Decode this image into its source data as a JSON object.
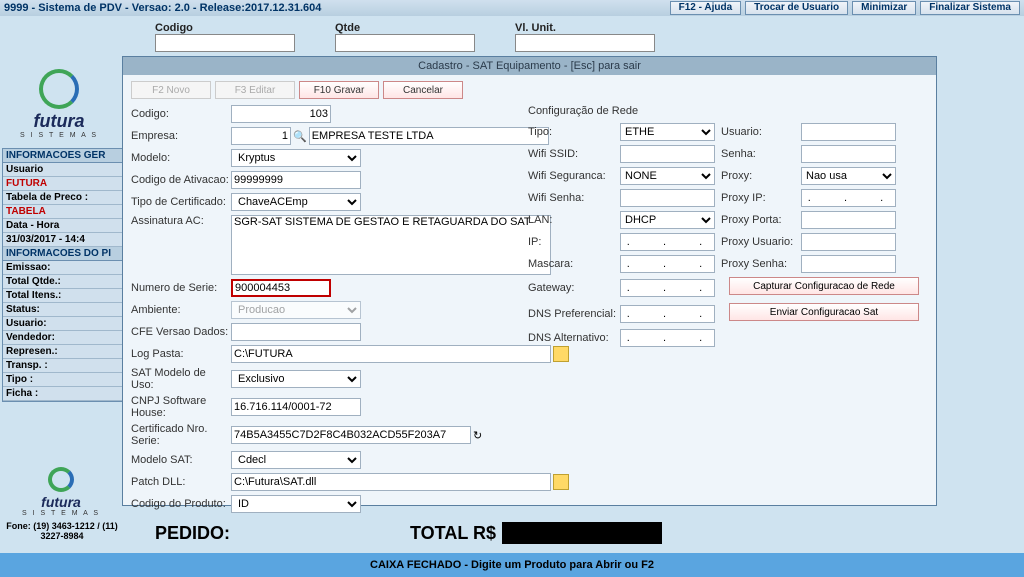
{
  "titlebar": {
    "text": "9999 - Sistema de PDV - Versao: 2.0 - Release:2017.12.31.604",
    "buttons": {
      "help": "F12 - Ajuda",
      "switch": "Trocar de Usuario",
      "min": "Minimizar",
      "exit": "Finalizar Sistema"
    }
  },
  "topfields": {
    "codigo": "Codigo",
    "qtde": "Qtde",
    "vlunit": "Vl. Unit."
  },
  "logo": {
    "brand": "futura",
    "sub": "S I S T E M A S"
  },
  "side": {
    "info_title": "INFORMACOES GER",
    "usuario_lbl": "Usuario",
    "usuario_val": "FUTURA",
    "tabela_lbl": "Tabela de Preco :",
    "tabela_val": "TABELA",
    "datahora_lbl": "Data - Hora",
    "datahora_val": "31/03/2017 - 14:4",
    "infopi": "INFORMACOES DO PI",
    "rows": [
      "Emissao:",
      "Total Qtde.:",
      "Total Itens.:",
      "Status:",
      "Usuario:",
      "Vendedor:",
      "Represen.:",
      "Transp. :",
      "Tipo :",
      "Ficha :"
    ],
    "fone": "Fone: (19) 3463-1212 / (11) 3227-8984"
  },
  "order": {
    "pedido": "PEDIDO:",
    "total": "TOTAL R$"
  },
  "status": "CAIXA FECHADO - Digite um Produto para Abrir ou F2",
  "modal": {
    "title": "Cadastro - SAT Equipamento - [Esc] para sair",
    "btns": {
      "novo": "F2 Novo",
      "editar": "F3 Editar",
      "gravar": "F10 Gravar",
      "cancelar": "Cancelar"
    },
    "left": {
      "codigo": "Codigo:",
      "codigo_val": "103",
      "empresa": "Empresa:",
      "empresa_num": "1",
      "empresa_name": "EMPRESA TESTE LTDA",
      "modelo": "Modelo:",
      "modelo_val": "Kryptus",
      "ativacao": "Codigo de Ativacao:",
      "ativacao_val": "99999999",
      "tipocert": "Tipo de Certificado:",
      "tipocert_val": "ChaveACEmp",
      "assinatura": "Assinatura AC:",
      "assinatura_val": "SGR-SAT SISTEMA DE GESTAO E RETAGUARDA DO SAT",
      "numserie": "Numero de Serie:",
      "numserie_val": "900004453",
      "ambiente": "Ambiente:",
      "ambiente_val": "Producao",
      "cfe": "CFE Versao Dados:",
      "logpasta": "Log Pasta:",
      "logpasta_val": "C:\\FUTURA",
      "satmodelo": "SAT Modelo de Uso:",
      "satmodelo_val": "Exclusivo",
      "cnpj": "CNPJ Software House:",
      "cnpj_val": "16.716.114/0001-72",
      "certnro": "Certificado Nro. Serie:",
      "certnro_val": "74B5A3455C7D2F8C4B032ACD55F203A7",
      "modelosat": "Modelo SAT:",
      "modelosat_val": "Cdecl",
      "patch": "Patch DLL:",
      "patch_val": "C:\\Futura\\SAT.dll",
      "codprod": "Codigo do Produto:",
      "codprod_val": "ID"
    },
    "right": {
      "title": "Configuração de Rede",
      "tipo": "Tipo:",
      "tipo_val": "ETHE",
      "ssid": "Wifi SSID:",
      "wifiseg": "Wifi Seguranca:",
      "wifiseg_val": "NONE",
      "wifisenha": "Wifi Senha:",
      "lan": "LAN:",
      "lan_val": "DHCP",
      "ip": "IP:",
      "mascara": "Mascara:",
      "gateway": "Gateway:",
      "dnspref": "DNS Preferencial:",
      "dnsalt": "DNS Alternativo:",
      "usuario": "Usuario:",
      "senha": "Senha:",
      "proxy": "Proxy:",
      "proxy_val": "Nao usa",
      "proxyip": "Proxy IP:",
      "proxyporta": "Proxy Porta:",
      "proxyuser": "Proxy Usuario:",
      "proxysenha": "Proxy Senha:",
      "btn_cap": "Capturar Configuracao de Rede",
      "btn_env": "Enviar Configuracao Sat",
      "dots": ".   .   ."
    }
  }
}
